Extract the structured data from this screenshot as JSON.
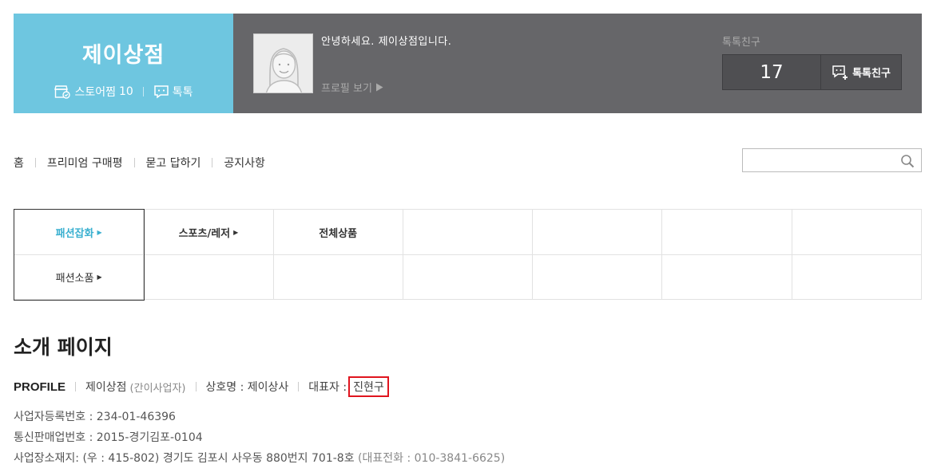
{
  "store": {
    "name": "제이상점",
    "wish_label": "스토어찜",
    "wish_count": "10",
    "talk_label": "톡톡"
  },
  "profile": {
    "greeting": "안녕하세요. 제이상점입니다.",
    "link_label": "프로필 보기"
  },
  "friends": {
    "label": "톡톡친구",
    "count": "17",
    "button_label": "톡톡친구"
  },
  "nav": {
    "items": [
      "홈",
      "프리미엄 구매평",
      "묻고 답하기",
      "공지사항"
    ]
  },
  "search": {
    "placeholder": ""
  },
  "categories": {
    "row1": [
      "패션잡화",
      "스포츠/레저",
      "전체상품"
    ],
    "row2": [
      "패션소품"
    ]
  },
  "intro": {
    "title": "소개 페이지",
    "profile_label": "PROFILE",
    "store_name": "제이상점",
    "store_type": "(간이사업자)",
    "company_label": "상호명 : 제이상사",
    "rep_label": "대표자 :",
    "rep_name": "진현구",
    "biz_reg": "사업자등록번호 : 234-01-46396",
    "mail_order": "통신판매업번호 : 2015-경기김포-0104",
    "address": "사업장소재지: (우 : 415-802) 경기도 김포시 사우동 880번지 701-8호",
    "phone": "(대표전화 : 010-3841-6625)"
  },
  "colors": {
    "brand": "#6ec6e0",
    "header_dark": "#666669",
    "active_category": "#3ab0d0",
    "highlight": "#e0141e"
  }
}
